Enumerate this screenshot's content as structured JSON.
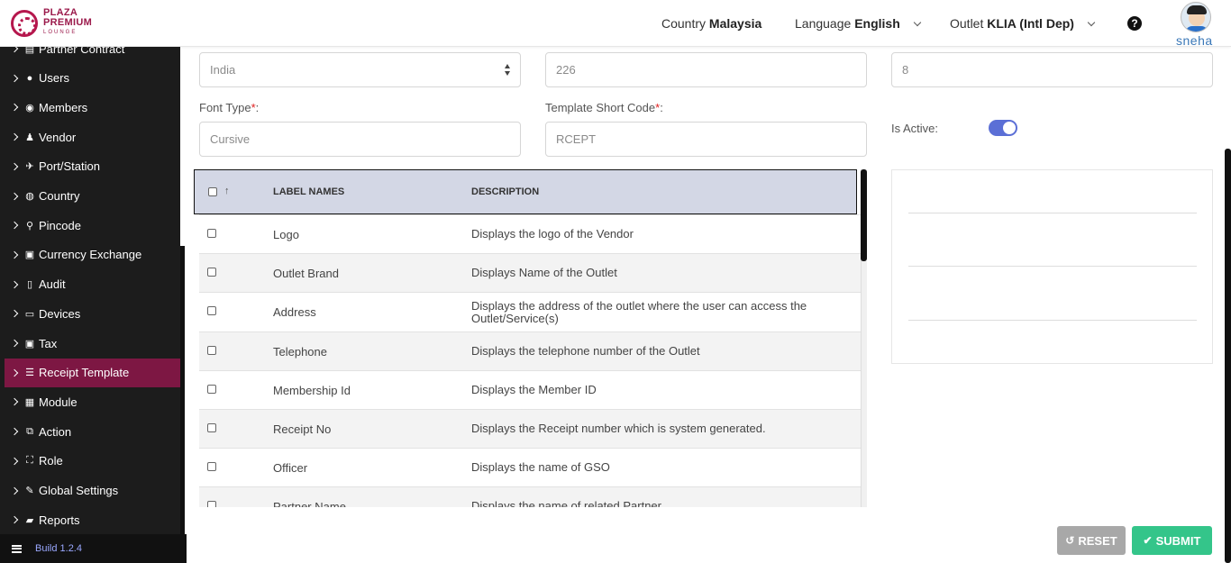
{
  "header": {
    "logo_line1": "PLAZA",
    "logo_line2": "PREMIUM",
    "logo_line3": "LOUNGE",
    "country_label": "Country",
    "country_value": "Malaysia",
    "language_label": "Language",
    "language_value": "English",
    "outlet_label": "Outlet",
    "outlet_value": "KLIA (Intl Dep)",
    "help_glyph": "?",
    "username": "sneha"
  },
  "sidebar": {
    "items": [
      {
        "label": "Partner Contract",
        "icon": "briefcase-icon",
        "glyph": "▤"
      },
      {
        "label": "Users",
        "icon": "user-icon",
        "glyph": "●"
      },
      {
        "label": "Members",
        "icon": "users-icon",
        "glyph": "◉"
      },
      {
        "label": "Vendor",
        "icon": "person-icon",
        "glyph": "♟"
      },
      {
        "label": "Port/Station",
        "icon": "plane-icon",
        "glyph": "✈"
      },
      {
        "label": "Country",
        "icon": "globe-icon",
        "glyph": "◍"
      },
      {
        "label": "Pincode",
        "icon": "map-marker-icon",
        "glyph": "⚲"
      },
      {
        "label": "Currency Exchange",
        "icon": "money-icon",
        "glyph": "▣"
      },
      {
        "label": "Audit",
        "icon": "file-icon",
        "glyph": "▯"
      },
      {
        "label": "Devices",
        "icon": "laptop-icon",
        "glyph": "▭"
      },
      {
        "label": "Tax",
        "icon": "money-icon",
        "glyph": "▣"
      },
      {
        "label": "Receipt Template",
        "icon": "list-alt-icon",
        "glyph": "☰",
        "active": true
      },
      {
        "label": "Module",
        "icon": "th-icon",
        "glyph": "▦"
      },
      {
        "label": "Action",
        "icon": "external-link-icon",
        "glyph": "⧉"
      },
      {
        "label": "Role",
        "icon": "id-badge-icon",
        "glyph": "⛶"
      },
      {
        "label": "Global Settings",
        "icon": "wrench-icon",
        "glyph": "✎"
      },
      {
        "label": "Reports",
        "icon": "book-icon",
        "glyph": "▰"
      }
    ],
    "build": "Build 1.2.4"
  },
  "form": {
    "country_select": "India",
    "field2_value": "226",
    "field3_value": "8",
    "font_type_label": "Font Type",
    "font_type_value": "Cursive",
    "short_code_label": "Template Short Code",
    "short_code_value": "RCEPT",
    "required_mark": "*",
    "label_colon": ":",
    "is_active_label": "Is Active:",
    "is_active": true
  },
  "table": {
    "sort_glyph": "↑",
    "col_label": "LABEL NAMES",
    "col_desc": "DESCRIPTION",
    "rows": [
      {
        "name": "Logo",
        "desc": "Displays the logo of the Vendor"
      },
      {
        "name": "Outlet Brand",
        "desc": "Displays Name of the Outlet"
      },
      {
        "name": "Address",
        "desc": "Displays the address of the outlet where the user can access the Outlet/Service(s)"
      },
      {
        "name": "Telephone",
        "desc": "Displays the telephone number of the Outlet"
      },
      {
        "name": "Membership Id",
        "desc": "Displays the Member ID"
      },
      {
        "name": "Receipt No",
        "desc": "Displays the Receipt number which is system generated."
      },
      {
        "name": "Officer",
        "desc": "Displays the name of GSO"
      },
      {
        "name": "Partner Name",
        "desc": "Displays the name of related Partner"
      }
    ]
  },
  "buttons": {
    "reset": "RESET",
    "reset_icon": "undo-icon",
    "submit": "SUBMIT",
    "submit_icon": "check-icon"
  }
}
